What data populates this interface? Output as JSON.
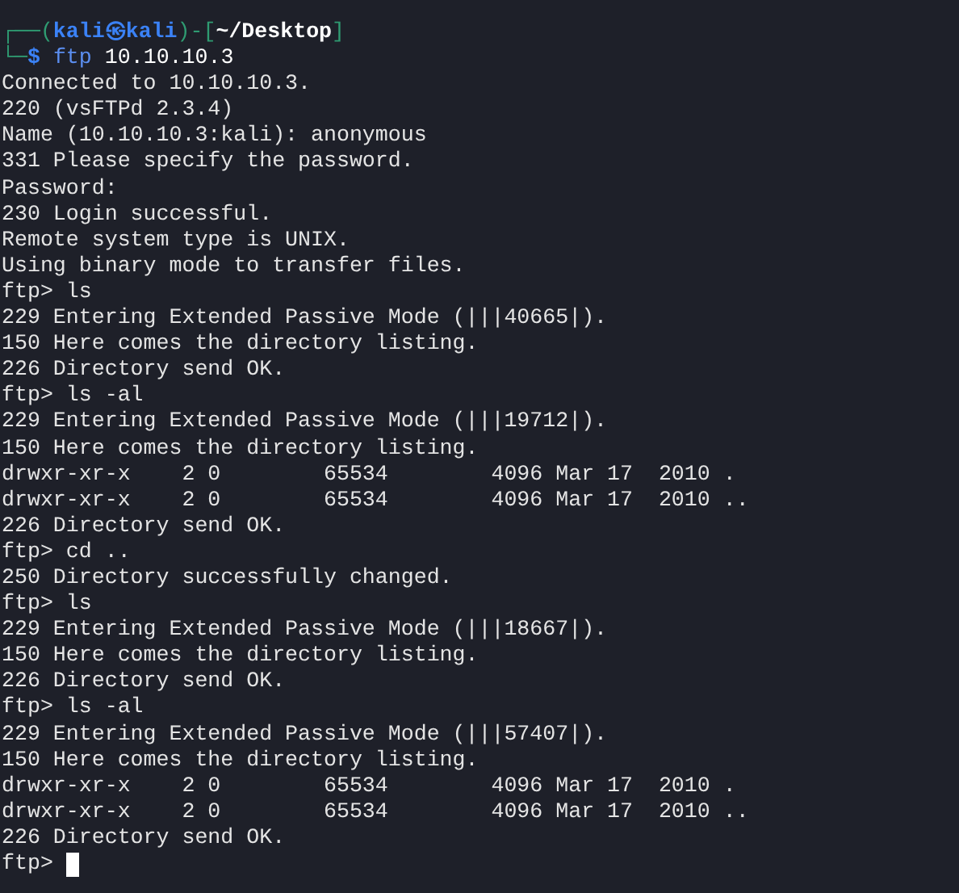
{
  "prompt": {
    "frame_top": "┌──(",
    "user_host": "kali㉿kali",
    "separator": ")-[",
    "path": "~/Desktop",
    "frame_close": "]",
    "frame_bottom": "└─",
    "symbol": "$",
    "command": "ftp",
    "args": "10.10.10.3"
  },
  "lines": [
    "Connected to 10.10.10.3.",
    "220 (vsFTPd 2.3.4)",
    "Name (10.10.10.3:kali): anonymous",
    "331 Please specify the password.",
    "Password:",
    "230 Login successful.",
    "Remote system type is UNIX.",
    "Using binary mode to transfer files.",
    "ftp> ls",
    "229 Entering Extended Passive Mode (|||40665|).",
    "150 Here comes the directory listing.",
    "226 Directory send OK.",
    "ftp> ls -al",
    "229 Entering Extended Passive Mode (|||19712|).",
    "150 Here comes the directory listing.",
    "drwxr-xr-x    2 0        65534        4096 Mar 17  2010 .",
    "drwxr-xr-x    2 0        65534        4096 Mar 17  2010 ..",
    "226 Directory send OK.",
    "ftp> cd ..",
    "250 Directory successfully changed.",
    "ftp> ls",
    "229 Entering Extended Passive Mode (|||18667|).",
    "150 Here comes the directory listing.",
    "226 Directory send OK.",
    "ftp> ls -al",
    "229 Entering Extended Passive Mode (|||57407|).",
    "150 Here comes the directory listing.",
    "drwxr-xr-x    2 0        65534        4096 Mar 17  2010 .",
    "drwxr-xr-x    2 0        65534        4096 Mar 17  2010 ..",
    "226 Directory send OK."
  ],
  "final_prompt": "ftp>"
}
